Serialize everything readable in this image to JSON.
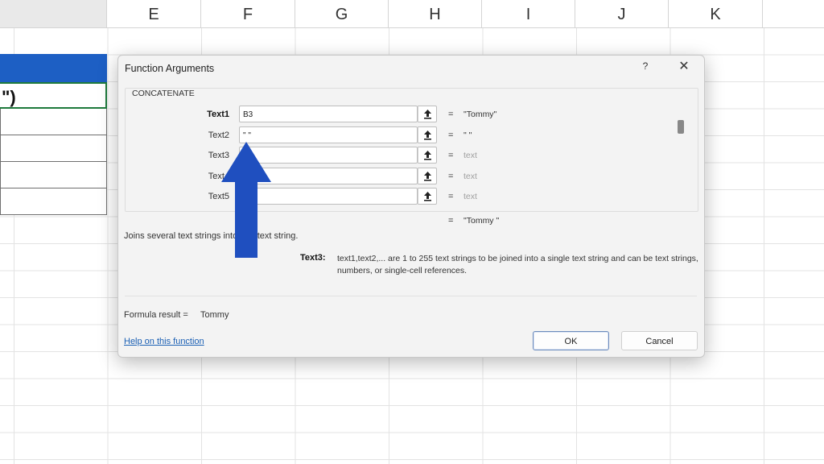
{
  "spreadsheet": {
    "columns": [
      "E",
      "F",
      "G",
      "H",
      "I",
      "J",
      "K"
    ],
    "visible_cell_text": "\")"
  },
  "dialog": {
    "title": "Function Arguments",
    "help_symbol": "?",
    "close_symbol": "✕",
    "function_name": "CONCATENATE",
    "arguments": [
      {
        "label": "Text1",
        "value": "B3",
        "result": "\"Tommy\"",
        "bold": true,
        "result_placeholder": false
      },
      {
        "label": "Text2",
        "value": "\" \"",
        "result": "\" \"",
        "bold": false,
        "result_placeholder": false
      },
      {
        "label": "Text3",
        "value": "",
        "result": "text",
        "bold": false,
        "result_placeholder": true
      },
      {
        "label": "Text4",
        "value": "",
        "result": "text",
        "bold": false,
        "result_placeholder": true
      },
      {
        "label": "Text5",
        "value": "",
        "result": "text",
        "bold": false,
        "result_placeholder": true
      }
    ],
    "equals": "=",
    "overall_result": "\"Tommy \"",
    "description": "Joins several text strings into one text string.",
    "arg_description": {
      "name": "Text3:",
      "text": "text1,text2,... are 1 to 255 text strings to be joined into a single text string and can be text strings, numbers, or single-cell references."
    },
    "formula_result_label": "Formula result =",
    "formula_result_value": "Tommy",
    "help_link": "Help on this function",
    "ok_label": "OK",
    "cancel_label": "Cancel"
  },
  "colors": {
    "table_header": "#1d5fc4",
    "arrow": "#1f4fbf",
    "link": "#1a5fb4"
  },
  "icons": {
    "collapse_dialog": "upload-arrow-icon",
    "overlay": "up-arrow-annotation"
  }
}
